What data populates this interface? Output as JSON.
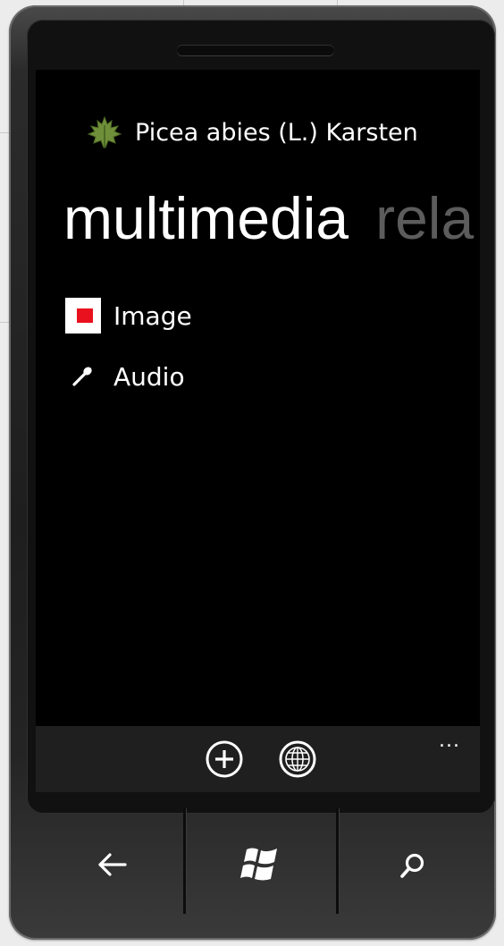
{
  "app": {
    "title": "Picea abies (L.) Karsten",
    "title_icon": "maple-leaf-icon"
  },
  "pivot": {
    "active_label": "multimedia",
    "next_label": "rela"
  },
  "list": {
    "items": [
      {
        "label": "Image",
        "icon": "image-thumbnail-icon"
      },
      {
        "label": "Audio",
        "icon": "microphone-icon"
      }
    ]
  },
  "appbar": {
    "buttons": [
      {
        "name": "add",
        "icon": "plus-circle-icon"
      },
      {
        "name": "web",
        "icon": "globe-icon"
      }
    ],
    "more": "..."
  },
  "hardware": {
    "buttons": [
      {
        "name": "back",
        "icon": "back-arrow-icon"
      },
      {
        "name": "start",
        "icon": "windows-logo-icon"
      },
      {
        "name": "search",
        "icon": "search-icon"
      }
    ]
  },
  "colors": {
    "screen_background": "#000000",
    "accent": "#e8111d",
    "pivot_inactive": "#5c5c5c",
    "appbar": "#1f1f1f"
  }
}
